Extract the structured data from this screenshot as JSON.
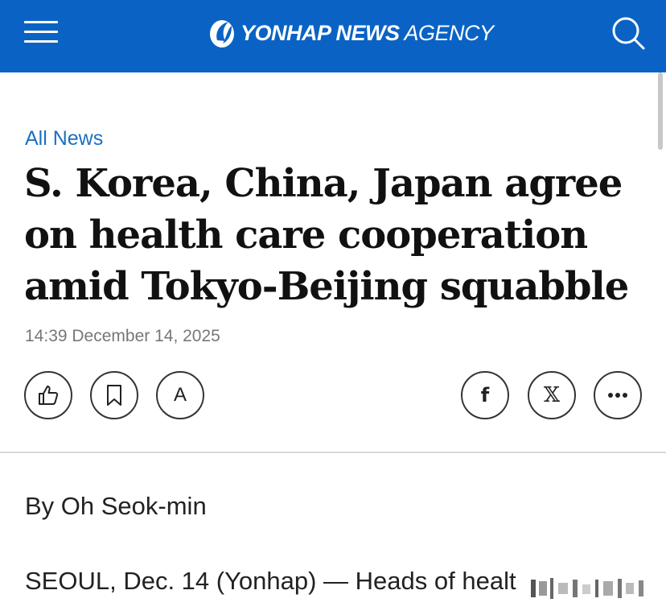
{
  "header": {
    "logo_main": "YONHAP NEWS",
    "logo_sub": "AGENCY",
    "brand_color": "#0a63c4",
    "icons": [
      "menu-icon",
      "search-icon"
    ]
  },
  "article": {
    "category": "All News",
    "headline": "S. Korea, China, Japan agree on health care cooperation amid Tokyo-Beijing squabble",
    "timestamp": "14:39 December 14, 2025",
    "byline": "By Oh Seok-min",
    "body_start": "SEOUL, Dec. 14 (Yonhap) — Heads of healt"
  },
  "actions": {
    "font_size_label": "A",
    "facebook_glyph": "f",
    "x_glyph": "𝕏",
    "icons": [
      "thumbs-up-icon",
      "bookmark-icon",
      "font-size-icon",
      "facebook-icon",
      "x-icon",
      "more-icon"
    ]
  }
}
